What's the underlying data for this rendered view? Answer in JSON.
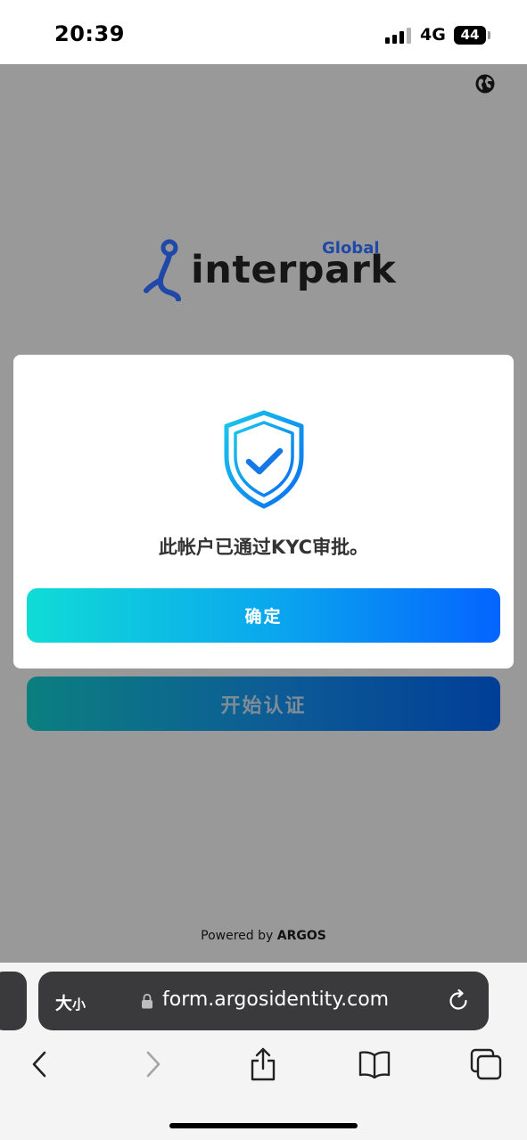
{
  "status_bar": {
    "time": "20:39",
    "network": "4G",
    "battery": "44"
  },
  "header": {
    "globe_icon": "globe-icon"
  },
  "logo": {
    "global": "Global",
    "wordmark": "interpark",
    "brand_color": "#1f48a8"
  },
  "main": {
    "start_button_label": "开始认证"
  },
  "modal": {
    "icon": "shield-check-icon",
    "message": "此帐户已通过KYC审批。",
    "confirm_label": "确定"
  },
  "footer": {
    "powered_prefix": "Powered by",
    "powered_brand": "ARGOS"
  },
  "browser": {
    "text_size_big": "大",
    "text_size_small": "小",
    "url": "form.argosidentity.com",
    "toolbar_icons": [
      "back-icon",
      "forward-icon",
      "share-icon",
      "bookmarks-icon",
      "tabs-icon"
    ]
  },
  "colors": {
    "overlay": "#999999",
    "confirm_gradient_start": "#10dcd6",
    "confirm_gradient_end": "#0464ff",
    "shield_start": "#19c9ea",
    "shield_end": "#0a6cf2"
  }
}
